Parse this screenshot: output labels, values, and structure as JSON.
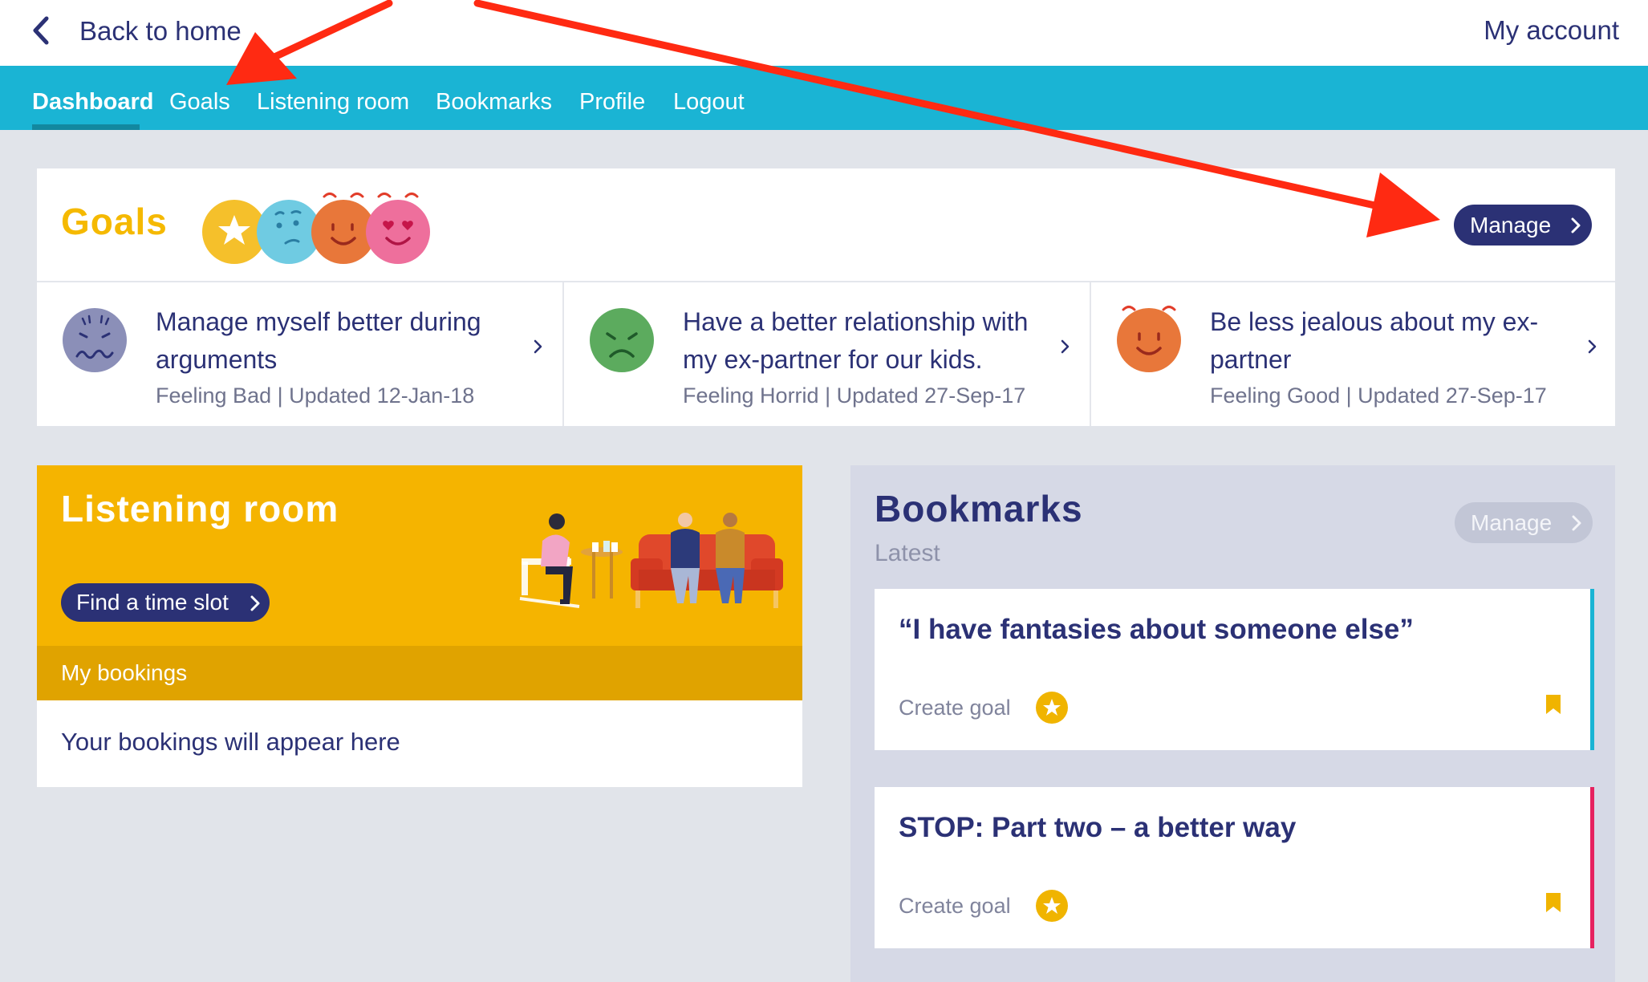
{
  "topbar": {
    "back_label": "Back to home",
    "account_label": "My account"
  },
  "nav": {
    "items": [
      {
        "label": "Dashboard",
        "active": true
      },
      {
        "label": "Goals"
      },
      {
        "label": "Listening room"
      },
      {
        "label": "Bookmarks"
      },
      {
        "label": "Profile"
      },
      {
        "label": "Logout"
      }
    ]
  },
  "goals": {
    "title": "Goals",
    "manage_label": "Manage",
    "header_faces": [
      "star-face-icon",
      "confused-face-icon",
      "happy-face-icon",
      "love-face-icon"
    ],
    "items": [
      {
        "title": "Manage myself better during arguments",
        "meta": "Feeling Bad | Updated 12-Jan-18",
        "face": "worried-face-icon",
        "face_color": "#8b8fb8"
      },
      {
        "title": "Have a better relationship with my ex-partner for our kids.",
        "meta": "Feeling Horrid | Updated 27-Sep-17",
        "face": "sad-face-icon",
        "face_color": "#5cab5e"
      },
      {
        "title": "Be less jealous about my ex-partner",
        "meta": "Feeling Good | Updated 27-Sep-17",
        "face": "happy-face-icon",
        "face_color": "#e8773a"
      }
    ]
  },
  "listening_room": {
    "title": "Listening room",
    "find_slot_label": "Find a time slot",
    "my_bookings_label": "My bookings",
    "empty_text": "Your bookings will appear here"
  },
  "bookmarks": {
    "title": "Bookmarks",
    "subtitle": "Latest",
    "manage_label": "Manage",
    "items": [
      {
        "title": "“I have fantasies about someone else”",
        "action_label": "Create goal",
        "accent": "#1ab4d4"
      },
      {
        "title": "STOP: Part two – a better way",
        "action_label": "Create goal",
        "accent": "#e6225f"
      }
    ]
  },
  "colors": {
    "brand_navy": "#2b3175",
    "nav_teal": "#1ab4d4",
    "goals_yellow": "#f5b900",
    "listening_yellow": "#f5b400",
    "annotation_red": "#ff2a12"
  }
}
